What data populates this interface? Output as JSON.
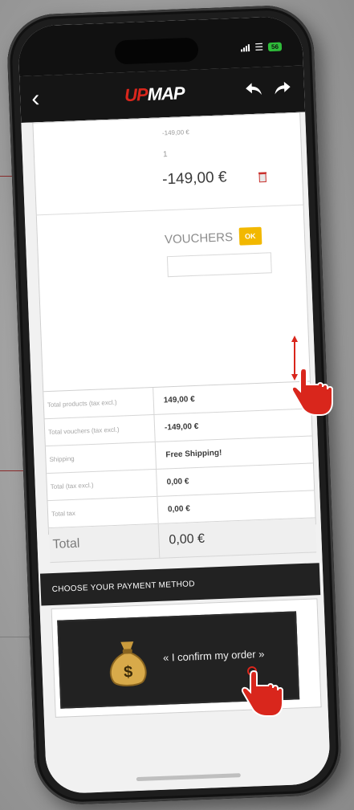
{
  "colors": {
    "accent": "#d9261c",
    "ok_button": "#f2b800",
    "dark_bar": "#222222",
    "battery": "#2fbd3a"
  },
  "status": {
    "battery": "56"
  },
  "nav": {
    "back_icon": "chevron-left-icon",
    "logo_part1": "UP",
    "logo_part2": "MAP",
    "undo_icon": "undo-icon",
    "redo_icon": "redo-icon"
  },
  "cart": {
    "unit_price": "-149,00 €",
    "quantity": "1",
    "line_total": "-149,00 €",
    "delete_icon": "trash-icon",
    "vouchers_label": "VOUCHERS",
    "vouchers_button": "OK",
    "voucher_input_value": ""
  },
  "totals": [
    {
      "label": "Total products (tax excl.)",
      "value": "149,00 €"
    },
    {
      "label": "Total vouchers (tax excl.)",
      "value": "-149,00 €"
    },
    {
      "label": "Shipping",
      "value": "Free Shipping!"
    },
    {
      "label": "Total (tax excl.)",
      "value": "0,00 €"
    },
    {
      "label": "Total tax",
      "value": "0,00 €"
    }
  ],
  "grand_total": {
    "label": "Total",
    "value": "0,00 €"
  },
  "payment": {
    "section_title": "CHOOSE YOUR PAYMENT METHOD",
    "confirm_label": "« I confirm my order »",
    "icon": "money-bag-icon"
  },
  "gestures": [
    "scroll-hand-icon",
    "tap-hand-icon"
  ]
}
